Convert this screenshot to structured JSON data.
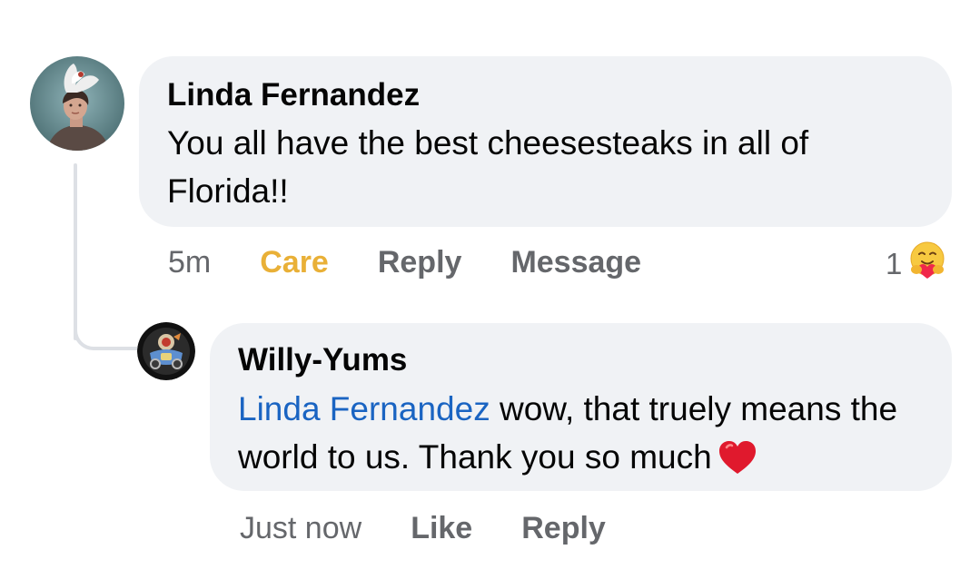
{
  "comment": {
    "author": "Linda Fernandez",
    "text": "You all have the best cheesesteaks in all of Florida!!",
    "timestamp": "5m",
    "actions": {
      "care": "Care",
      "reply": "Reply",
      "message": "Message"
    },
    "reaction_count": "1",
    "reaction_icon": "care-hug-emoji-icon"
  },
  "reply": {
    "author": "Willy-Yums",
    "mention": "Linda Fernandez",
    "text": " wow, that truely means the world to us. Thank you so much",
    "emoji_icon": "red-heart-icon",
    "timestamp": "Just now",
    "actions": {
      "like": "Like",
      "reply": "Reply"
    }
  },
  "colors": {
    "bubble": "#f0f2f5",
    "care_active": "#e9b037",
    "mention": "#1a64c2",
    "meta_gray": "#65676b"
  }
}
